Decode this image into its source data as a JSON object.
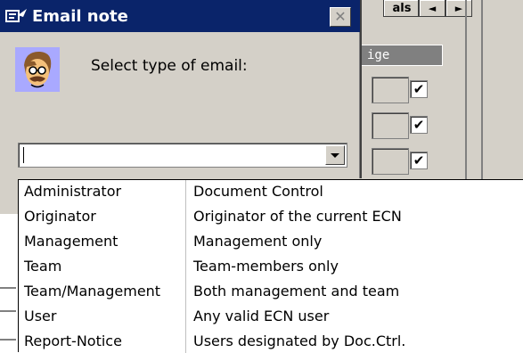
{
  "background": {
    "tab_label": "als",
    "nav_prev": "◄",
    "nav_next": "►",
    "column_header": "ige",
    "checkmark": "✔"
  },
  "dialog": {
    "title": "Email note",
    "title_icon": "email-note-icon",
    "close_label": "✕",
    "prompt": "Select type of email:",
    "combo_value": ""
  },
  "dropdown": {
    "items": [
      {
        "type": "Administrator",
        "description": "Document Control"
      },
      {
        "type": "Originator",
        "description": "Originator of the current ECN"
      },
      {
        "type": "Management",
        "description": "Management only"
      },
      {
        "type": "Team",
        "description": "Team-members only"
      },
      {
        "type": "Team/Management",
        "description": "Both management and team"
      },
      {
        "type": "User",
        "description": "Any valid ECN user"
      },
      {
        "type": "Report-Notice",
        "description": "Users designated by Doc.Ctrl."
      }
    ]
  }
}
